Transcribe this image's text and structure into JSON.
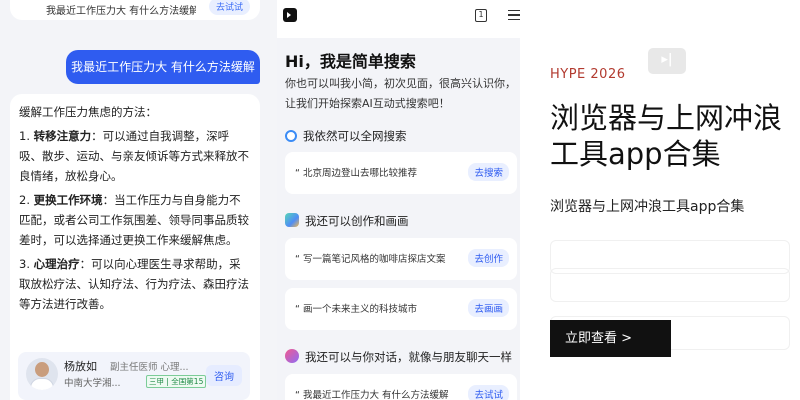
{
  "left_chat": {
    "top_bubble": {
      "text": "我最近工作压力大 有什么方法缓解",
      "button": "去试试"
    },
    "user_message": "我最近工作压力大 有什么方法缓解",
    "answer": {
      "intro": "缓解工作压力焦虑的方法：",
      "items": [
        {
          "num": "1.",
          "title": "转移注意力",
          "text": "：可以通过自我调整，深呼吸、散步、运动、与亲友倾诉等方式来释放不良情绪，放松身心。"
        },
        {
          "num": "2.",
          "title": "更换工作环境",
          "text": "：当工作压力与自身能力不匹配，或者公司工作氛围差、领导同事品质较差时，可以选择通过更换工作来缓解焦虑。"
        },
        {
          "num": "3.",
          "title": "心理治疗",
          "text": "：可以向心理医生寻求帮助，采取放松疗法、认知疗法、行为疗法、森田疗法等方法进行改善。"
        }
      ]
    },
    "doctor": {
      "name": "杨放如",
      "title": "副主任医师 心理...",
      "org": "中南大学湘...",
      "tag": "三甲 | 全国第15",
      "button": "咨询"
    }
  },
  "mid_app": {
    "title": "Hi，我是简单搜索",
    "intro": "你也可以叫我小简，初次见面，很高兴认识你，让我们开始探索AI互动式搜索吧！",
    "header_icon_1": "1",
    "sections": [
      {
        "heading": "我依然可以全网搜索",
        "icon": "search-icon",
        "prompts": [
          {
            "text": "北京周边登山去哪比较推荐",
            "button": "去搜索"
          }
        ]
      },
      {
        "heading": "我还可以创作和画画",
        "icon": "create-icon",
        "prompts": [
          {
            "text": "写一篇笔记风格的咖啡店探店文案",
            "button": "去创作"
          },
          {
            "text": "画一个未来主义的科技城市",
            "button": "去画画"
          }
        ]
      },
      {
        "heading": "我还可以与你对话，就像与朋友聊天一样",
        "icon": "chat-icon",
        "prompts": [
          {
            "text": "我最近工作压力大 有什么方法缓解",
            "button": "去试试"
          }
        ]
      }
    ]
  },
  "promo": {
    "eyebrow": "HYPE 2026",
    "title": "浏览器与上网冲浪工具app合集",
    "subtitle": "浏览器与上网冲浪工具app合集",
    "cta": "立即查看 >"
  },
  "colors": {
    "accent_blue": "#2f5cf0",
    "eyebrow_red": "#b23a2f",
    "cta_black": "#111111"
  }
}
